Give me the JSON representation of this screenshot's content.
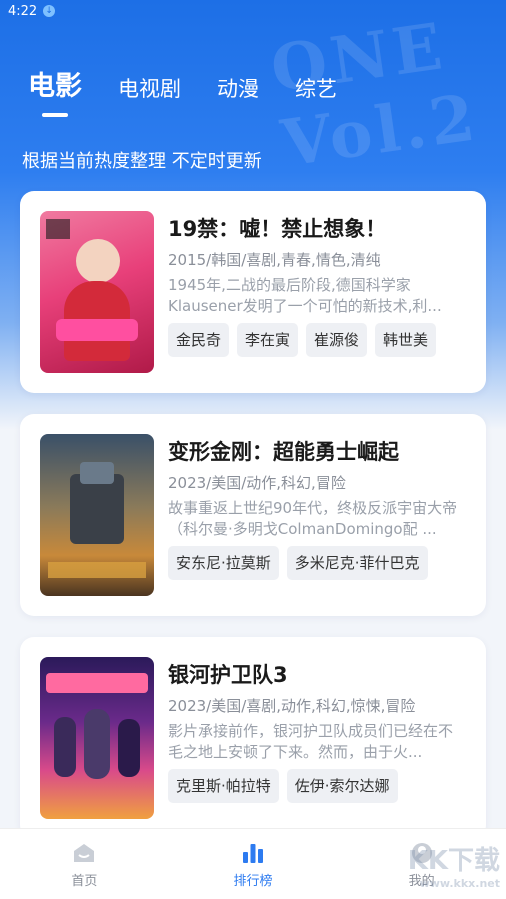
{
  "status_bar": {
    "time": "4:22"
  },
  "tabs": [
    {
      "label": "电影",
      "active": true
    },
    {
      "label": "电视剧",
      "active": false
    },
    {
      "label": "动漫",
      "active": false
    },
    {
      "label": "综艺",
      "active": false
    }
  ],
  "subtitle": "根据当前热度整理 不定时更新",
  "movies": [
    {
      "title": "19禁：嘘！禁止想象！",
      "meta": "2015/韩国/喜剧,青春,情色,清纯",
      "desc": "1945年,二战的最后阶段,德国科学家Klausener发明了一个可怕的新技术,利...",
      "tags": [
        "金民奇",
        "李在寅",
        "崔源俊",
        "韩世美"
      ],
      "poster_colors": [
        "#e8407a",
        "#ff8fb0",
        "#c91c4e"
      ]
    },
    {
      "title": "变形金刚：超能勇士崛起",
      "meta": "2023/美国/动作,科幻,冒险",
      "desc": "故事重返上世纪90年代，终极反派宇宙大帝（科尔曼·多明戈ColmanDomingo配 ...",
      "tags": [
        "安东尼·拉莫斯",
        "多米尼克·菲什巴克"
      ],
      "poster_colors": [
        "#2a3a4a",
        "#c8893a",
        "#6a4a2a"
      ]
    },
    {
      "title": "银河护卫队3",
      "meta": "2023/美国/喜剧,动作,科幻,惊悚,冒险",
      "desc": "影片承接前作，银河护卫队成员们已经在不毛之地上安顿了下来。然而，由于火...",
      "tags": [
        "克里斯·帕拉特",
        "佐伊·索尔达娜"
      ],
      "poster_colors": [
        "#2b1a5a",
        "#d94a8a",
        "#f0a040"
      ]
    }
  ],
  "bottom_nav": [
    {
      "label": "首页",
      "icon": "home-icon",
      "active": false
    },
    {
      "label": "排行榜",
      "icon": "ranking-icon",
      "active": true
    },
    {
      "label": "我的",
      "icon": "profile-icon",
      "active": false
    }
  ],
  "watermark": {
    "text": "KK下载",
    "url": "www.kkx.net"
  }
}
